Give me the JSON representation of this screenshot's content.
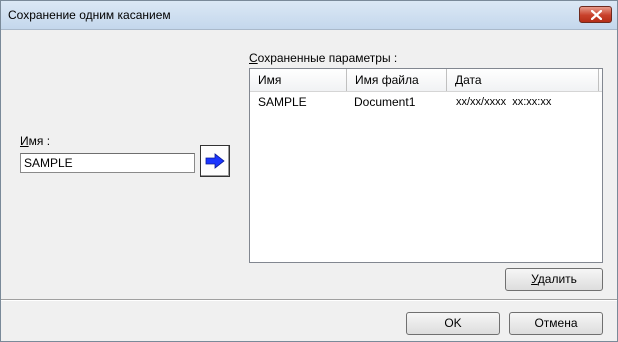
{
  "window": {
    "title": "Сохранение одним касанием"
  },
  "name_section": {
    "label_accel": "И",
    "label_rest": "мя :",
    "input_value": "SAMPLE"
  },
  "saved_section": {
    "label_accel": "С",
    "label_rest": "охраненные параметры :",
    "columns": [
      "Имя",
      "Имя файла",
      "Дата"
    ],
    "rows": [
      {
        "name": "SAMPLE",
        "file": "Document1",
        "date": "xx/xx/xxxx  xx:xx:xx"
      }
    ],
    "delete_accel": "У",
    "delete_rest": "далить"
  },
  "footer": {
    "ok_label": "OK",
    "cancel_label": "Отмена"
  },
  "icons": {
    "close": "close-x-icon",
    "arrow": "right-arrow-icon"
  },
  "colors": {
    "arrow": "#1a35ff",
    "close": "#c8412b"
  }
}
